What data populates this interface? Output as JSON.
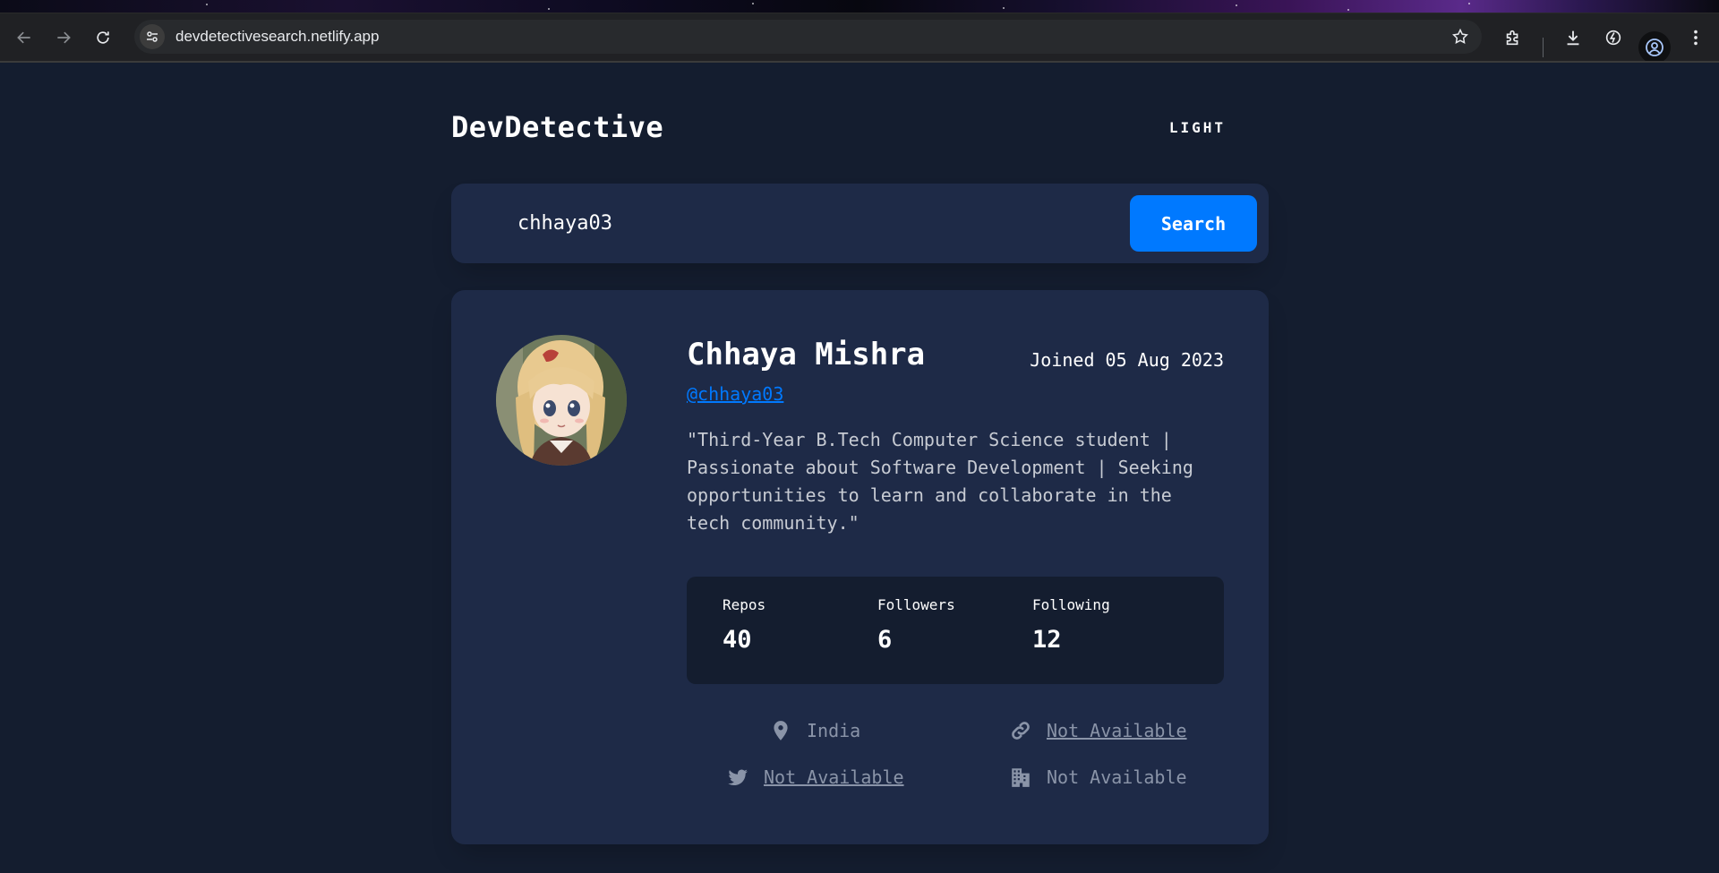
{
  "browser": {
    "url": "devdetectivesearch.netlify.app"
  },
  "app": {
    "logo": "DevDetective",
    "theme_toggle": "LIGHT"
  },
  "search": {
    "value": "chhaya03",
    "button_label": "Search"
  },
  "profile": {
    "name": "Chhaya Mishra",
    "joined": "Joined 05 Aug 2023",
    "username": "@chhaya03",
    "bio": "\"Third-Year B.Tech Computer Science student | Passionate about Software Development | Seeking opportunities to learn and collaborate in the tech community.\"",
    "stats": [
      {
        "label": "Repos",
        "value": "40"
      },
      {
        "label": "Followers",
        "value": "6"
      },
      {
        "label": "Following",
        "value": "12"
      }
    ],
    "links": {
      "location": "India",
      "website": "Not Available",
      "twitter": "Not Available",
      "company": "Not Available"
    }
  },
  "colors": {
    "background": "#141d2f",
    "card": "#1e2a47",
    "accent": "#0079ff"
  }
}
